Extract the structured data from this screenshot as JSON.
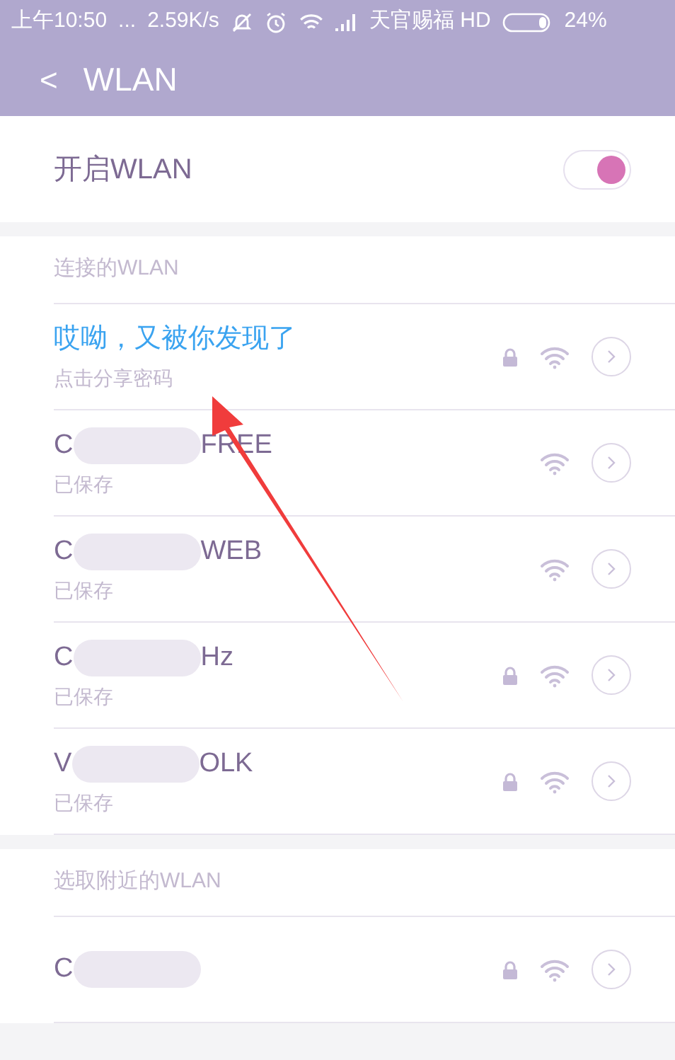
{
  "status_bar": {
    "time": "上午10:50",
    "dots": "...",
    "speed": "2.59K/s",
    "carrier": "天官赐福 HD",
    "battery": "24%"
  },
  "header": {
    "back": "<",
    "title": "WLAN"
  },
  "wlan_switch": {
    "label": "开启WLAN",
    "on": true
  },
  "sections": [
    {
      "title": "连接的WLAN",
      "networks": [
        {
          "name_start": "哎呦，又被你发现了",
          "blurred": false,
          "subtitle": "点击分享密码",
          "connected": true,
          "locked": true
        },
        {
          "name_start": "C",
          "blurred": true,
          "name_end": "FREE",
          "subtitle": "已保存",
          "connected": false,
          "locked": false
        },
        {
          "name_start": "C",
          "blurred": true,
          "name_end": "WEB",
          "subtitle": "已保存",
          "connected": false,
          "locked": false
        },
        {
          "name_start": "C",
          "blurred": true,
          "name_end": "Hz",
          "subtitle": "已保存",
          "connected": false,
          "locked": true
        },
        {
          "name_start": "V",
          "blurred": true,
          "name_end": "OLK",
          "subtitle": "已保存",
          "connected": false,
          "locked": true
        }
      ]
    },
    {
      "title": "选取附近的WLAN",
      "networks": [
        {
          "name_start": "C",
          "blurred": true,
          "connected": false,
          "locked": true
        }
      ]
    }
  ],
  "annotation": {
    "kind": "arrow"
  }
}
